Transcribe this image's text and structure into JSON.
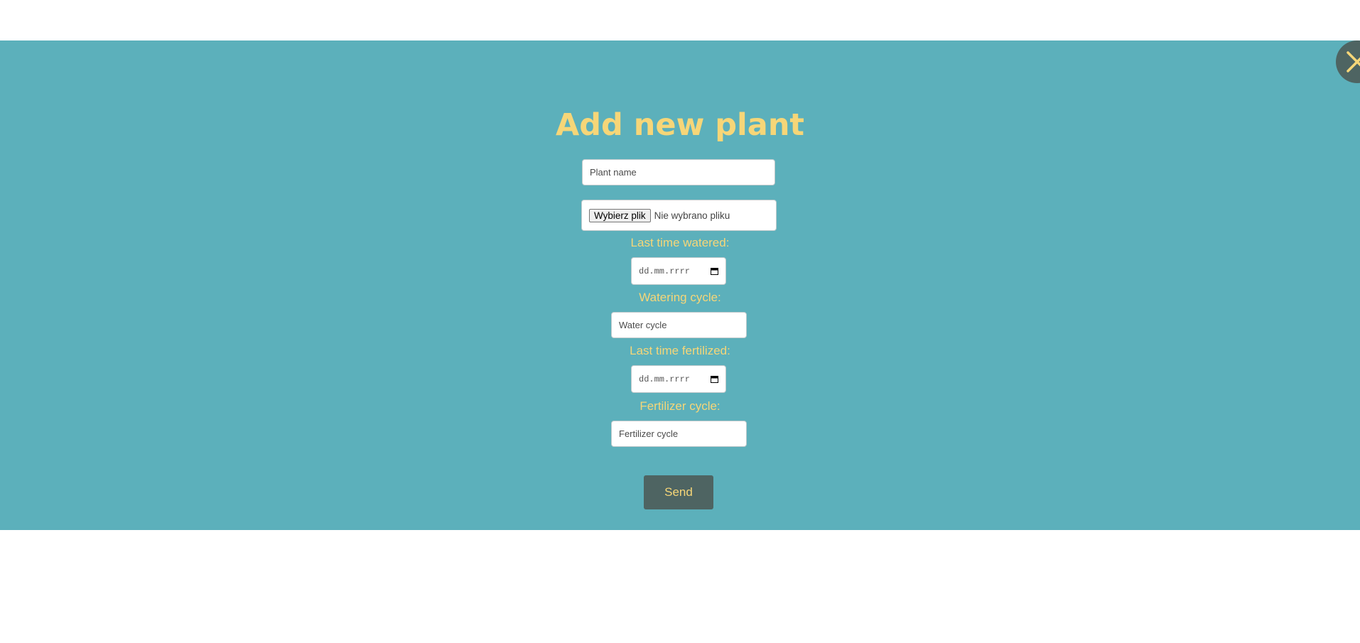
{
  "modal": {
    "title": "Add new plant",
    "close_icon": "close-icon",
    "colors": {
      "background": "#5cb0bb",
      "accent": "#f6d678",
      "button": "#4e6462"
    }
  },
  "form": {
    "plant_name_placeholder": "Plant name",
    "file_button_label": "Wybierz plik",
    "file_status": "Nie wybrano pliku",
    "last_watered_label": "Last time watered:",
    "last_watered_placeholder": "dd.mm.rrrr",
    "watering_cycle_label": "Watering cycle:",
    "watering_cycle_placeholder": "Water cycle",
    "last_fertilized_label": "Last time fertilized:",
    "last_fertilized_placeholder": "dd.mm.rrrr",
    "fertilizer_cycle_label": "Fertilizer cycle:",
    "fertilizer_cycle_placeholder": "Fertilizer cycle",
    "send_label": "Send",
    "calendar_icon": "calendar-icon"
  }
}
